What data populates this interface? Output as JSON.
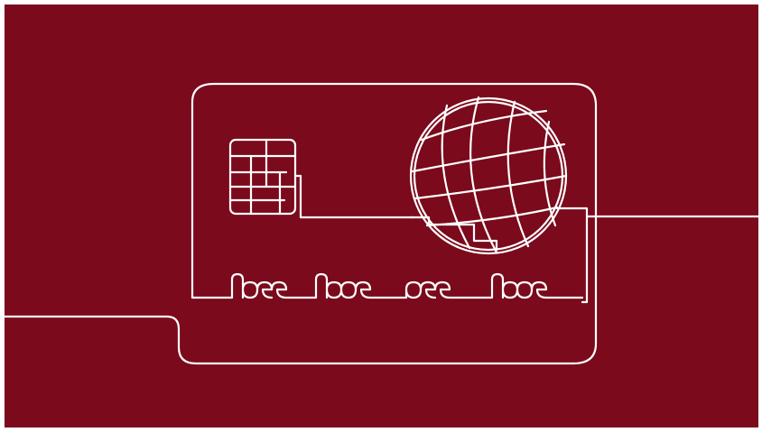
{
  "illustration": {
    "subject": "credit-card-line-art",
    "icons": [
      "card-outline-icon",
      "chip-icon",
      "globe-icon",
      "card-number-squiggle-icon",
      "connecting-line-icon"
    ],
    "colors": {
      "background": "#7a0a1c",
      "line": "#ffffff",
      "frame": "#ffffff"
    }
  }
}
